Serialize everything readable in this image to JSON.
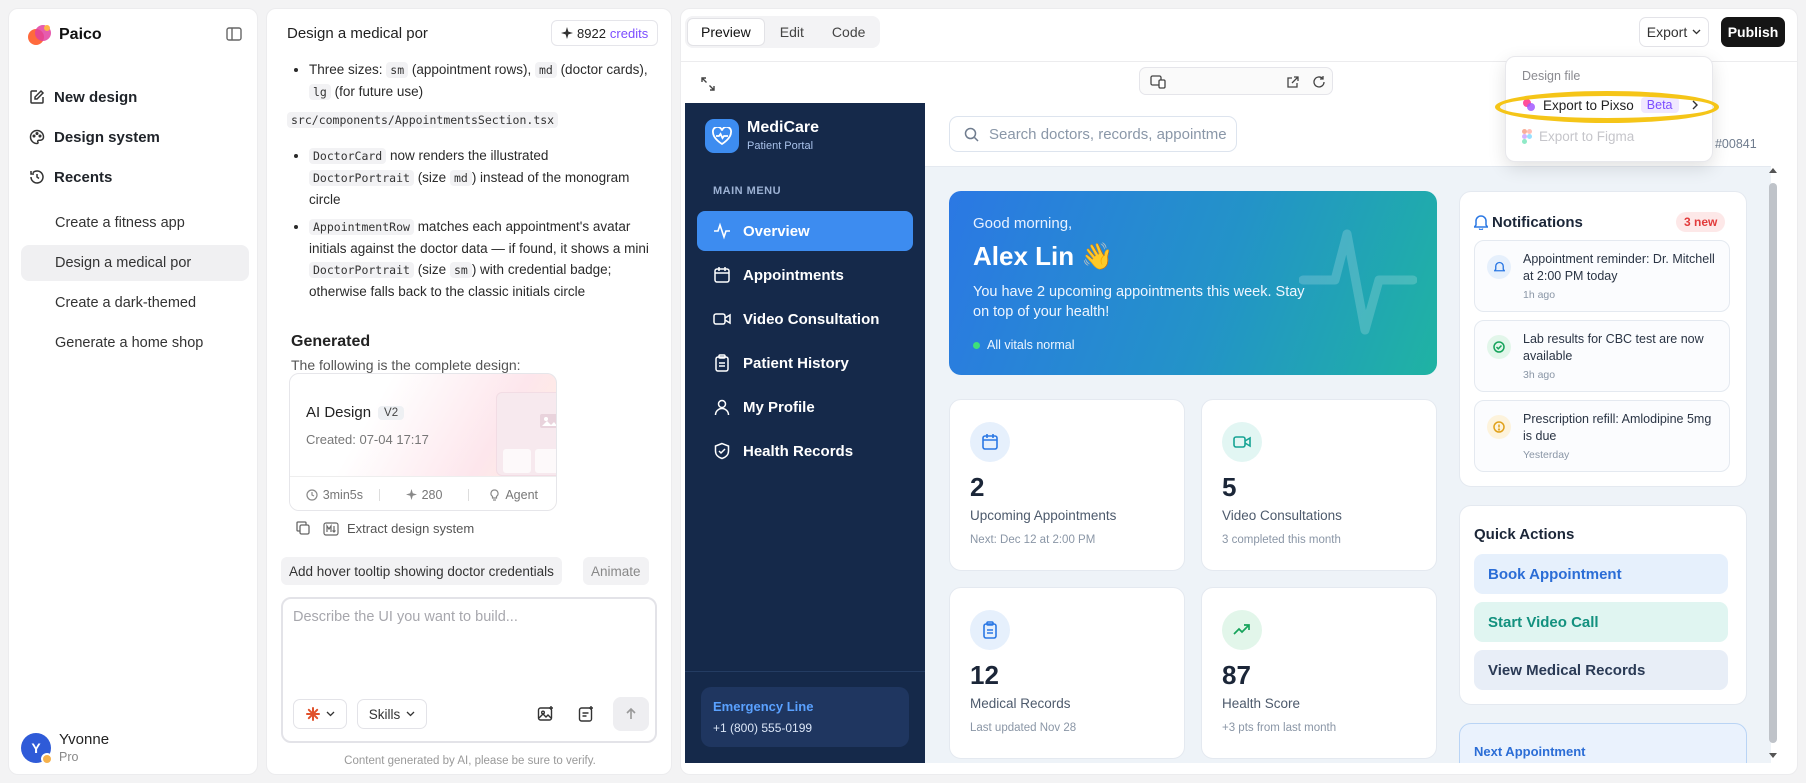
{
  "app": {
    "name": "Paico"
  },
  "sidebar": {
    "nav": [
      {
        "label": "New design",
        "icon": "edit-icon"
      },
      {
        "label": "Design system",
        "icon": "palette-icon"
      },
      {
        "label": "Recents",
        "icon": "history-icon"
      }
    ],
    "recents": [
      {
        "label": "Create a fitness app",
        "active": false
      },
      {
        "label": "Design a medical por",
        "active": true
      },
      {
        "label": "Create a dark-themed",
        "active": false
      },
      {
        "label": "Generate a home shop",
        "active": false
      }
    ],
    "user": {
      "initial": "Y",
      "name": "Yvonne",
      "plan": "Pro"
    }
  },
  "chat": {
    "title": "Design a medical por",
    "credits_value": "8922",
    "credits_label": "credits",
    "bullet1_a": "Three sizes: ",
    "bullet1_sm": "sm",
    "bullet1_b": " (appointment rows), ",
    "bullet1_md": "md",
    "bullet1_c": " (doctor cards), ",
    "bullet1_lg": "lg",
    "bullet1_d": " (for future use)",
    "file_path": "src/components/AppointmentsSection.tsx",
    "bullet2_code1": "DoctorCard",
    "bullet2_a": " now renders the illustrated ",
    "bullet2_code2": "DoctorPortrait",
    "bullet2_b": " (size ",
    "bullet2_code3": "md",
    "bullet2_c": ") instead of the monogram circle",
    "bullet3_code1": "AppointmentRow",
    "bullet3_a": " matches each appointment's avatar initials against the doctor data — if found, it shows a mini ",
    "bullet3_code2": "DoctorPortrait",
    "bullet3_b": " (size ",
    "bullet3_code3": "sm",
    "bullet3_c": ") with credential badge; otherwise falls back to the classic initials circle",
    "generated_title": "Generated",
    "generated_sub": "The following is the complete design:",
    "design_card": {
      "title": "AI Design",
      "version": "V2",
      "created": "Created: 07-04 17:17",
      "duration": "3min5s",
      "cost": "280",
      "mode": "Agent"
    },
    "extract_label": "Extract design system",
    "suggestions": [
      "Add hover tooltip showing doctor credentials",
      "Animate"
    ],
    "composer_placeholder": "Describe the UI you want to build...",
    "skills_label": "Skills",
    "disclaimer": "Content  generated by AI, please be sure to verify."
  },
  "preview": {
    "tabs": [
      {
        "label": "Preview",
        "active": true
      },
      {
        "label": "Edit",
        "active": false
      },
      {
        "label": "Code",
        "active": false
      }
    ],
    "export_label": "Export",
    "publish_label": "Publish",
    "dropdown": {
      "header": "Design file",
      "items": [
        {
          "label": "Export to Pixso",
          "badge": "Beta",
          "enabled": true
        },
        {
          "label": "Export to Figma",
          "enabled": false
        }
      ]
    }
  },
  "medicare": {
    "brand": "MediCare",
    "brand_sub": "Patient Portal",
    "menu_label": "MAIN MENU",
    "nav": [
      {
        "label": "Overview",
        "icon": "activity-icon",
        "active": true
      },
      {
        "label": "Appointments",
        "icon": "calendar-icon",
        "active": false
      },
      {
        "label": "Video Consultation",
        "icon": "video-icon",
        "active": false
      },
      {
        "label": "Patient History",
        "icon": "clipboard-icon",
        "active": false
      },
      {
        "label": "My Profile",
        "icon": "user-icon",
        "active": false
      },
      {
        "label": "Health Records",
        "icon": "shield-icon",
        "active": false
      }
    ],
    "emergency_title": "Emergency Line",
    "emergency_phone": "+1 (800) 555-0199",
    "search_placeholder": "Search doctors, records, appointme",
    "patient_id": "D: #00841",
    "hero": {
      "greeting": "Good morning,",
      "name": "Alex Lin 👋",
      "message": "You have 2 upcoming appointments this week. Stay on top of your health!",
      "vitals": "All vitals normal"
    },
    "stats": [
      {
        "value": "2",
        "label": "Upcoming Appointments",
        "sub": "Next: Dec 12 at 2:00 PM",
        "icon": "calendar-icon",
        "color": "#2b78e4",
        "bg": "#e6f0fc"
      },
      {
        "value": "5",
        "label": "Video Consultations",
        "sub": "3 completed this month",
        "icon": "video-icon",
        "color": "#16a394",
        "bg": "#e2f6f3"
      },
      {
        "value": "12",
        "label": "Medical Records",
        "sub": "Last updated Nov 28",
        "icon": "clipboard-icon",
        "color": "#2b78e4",
        "bg": "#e6f0fc"
      },
      {
        "value": "87",
        "label": "Health Score",
        "sub": "+3 pts from last month",
        "icon": "trend-up-icon",
        "color": "#16a35b",
        "bg": "#e2f6ea"
      }
    ],
    "notifications": {
      "title": "Notifications",
      "badge": "3 new",
      "items": [
        {
          "text": "Appointment reminder: Dr. Mitchell at 2:00 PM today",
          "time": "1h ago",
          "icon": "bell-icon",
          "color": "#2b78e4",
          "bg": "#e6f0fc"
        },
        {
          "text": "Lab results for CBC test are now available",
          "time": "3h ago",
          "icon": "check-circle-icon",
          "color": "#16a35b",
          "bg": "#e2f6ea"
        },
        {
          "text": "Prescription refill: Amlodipine 5mg is due",
          "time": "Yesterday",
          "icon": "clock-icon",
          "color": "#e0a11b",
          "bg": "#fdf3dc"
        }
      ]
    },
    "quick_actions": {
      "title": "Quick Actions",
      "items": [
        {
          "label": "Book Appointment",
          "color": "#2b6dd6",
          "bg": "#e6f0fc"
        },
        {
          "label": "Start Video Call",
          "color": "#13917f",
          "bg": "#e0f5f1"
        },
        {
          "label": "View Medical Records",
          "color": "#2a3a55",
          "bg": "#e8eef7"
        }
      ]
    },
    "next_appointment_title": "Next Appointment"
  }
}
